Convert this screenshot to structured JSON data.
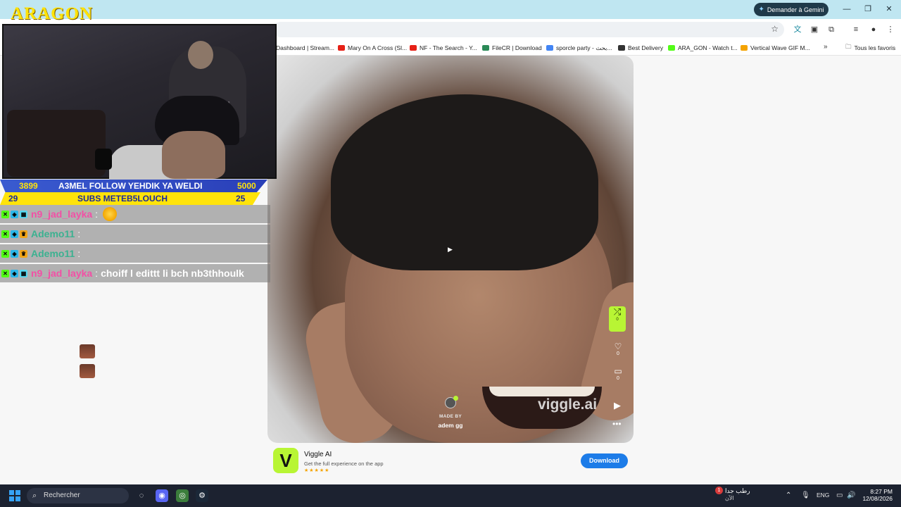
{
  "titlebar": {
    "gemini_label": "Demander à Gemini",
    "minimize": "—",
    "restore": "❐",
    "close": "✕"
  },
  "bookmarks": [
    {
      "label": "Dashboard | Stream...",
      "color": "#ffffff"
    },
    {
      "label": "Mary On A Cross (Sl...",
      "color": "#e62117"
    },
    {
      "label": "NF - The Search - Y...",
      "color": "#e62117"
    },
    {
      "label": "FileCR | Download",
      "color": "#2b8a57"
    },
    {
      "label": "sporcle party - بحث...",
      "color": "#4285f4"
    },
    {
      "label": "Best Delivery",
      "color": "#333333"
    },
    {
      "label": "ARA_GON - Watch t...",
      "color": "#53fc18"
    },
    {
      "label": "Vertical Wave GIF M...",
      "color": "#f4a300"
    }
  ],
  "bookmarks_all": "Tous les favoris",
  "stream": {
    "logo": "ARAGON",
    "goal_follow": {
      "current": "3899",
      "text": "A3MEL FOLLOW YEHDIK YA WELDI",
      "target": "5000"
    },
    "goal_subs": {
      "current": "29",
      "text": "SUBS METEB5LOUCH",
      "target": "25"
    },
    "chat": [
      {
        "user": "n9_jad_layka",
        "text": "",
        "emote": "laugh",
        "color": "pink"
      },
      {
        "user": "Ademo11",
        "text": "",
        "emote": "face",
        "color": "green"
      },
      {
        "user": "Ademo11",
        "text": "",
        "emote": "face",
        "color": "green"
      },
      {
        "user": "n9_jad_layka",
        "text": "choiff l edittt li bch nb3thhoulk",
        "emote": "",
        "color": "pink"
      }
    ]
  },
  "video": {
    "watermark": "viggle.ai",
    "made_by_label": "MADE BY",
    "author": "adem gg",
    "shuffle_count": "0",
    "like_count": "0",
    "comment_count": "0"
  },
  "promo": {
    "app_name": "Viggle AI",
    "subtitle": "Get the full experience on the app",
    "stars": "★★★★★",
    "download": "Download"
  },
  "taskbar": {
    "search_placeholder": "Rechercher",
    "weather_line1": "رطب جدا",
    "weather_line2": "الآن",
    "weather_badge": "1",
    "lang": "ENG",
    "time": "8:27 PM",
    "date": "12/08/2026"
  },
  "colors": {
    "accent_lime": "#b8f534",
    "goal_blue": "#2a3fb8",
    "goal_yellow": "#ffe30a",
    "download_blue": "#1d7ce8"
  }
}
